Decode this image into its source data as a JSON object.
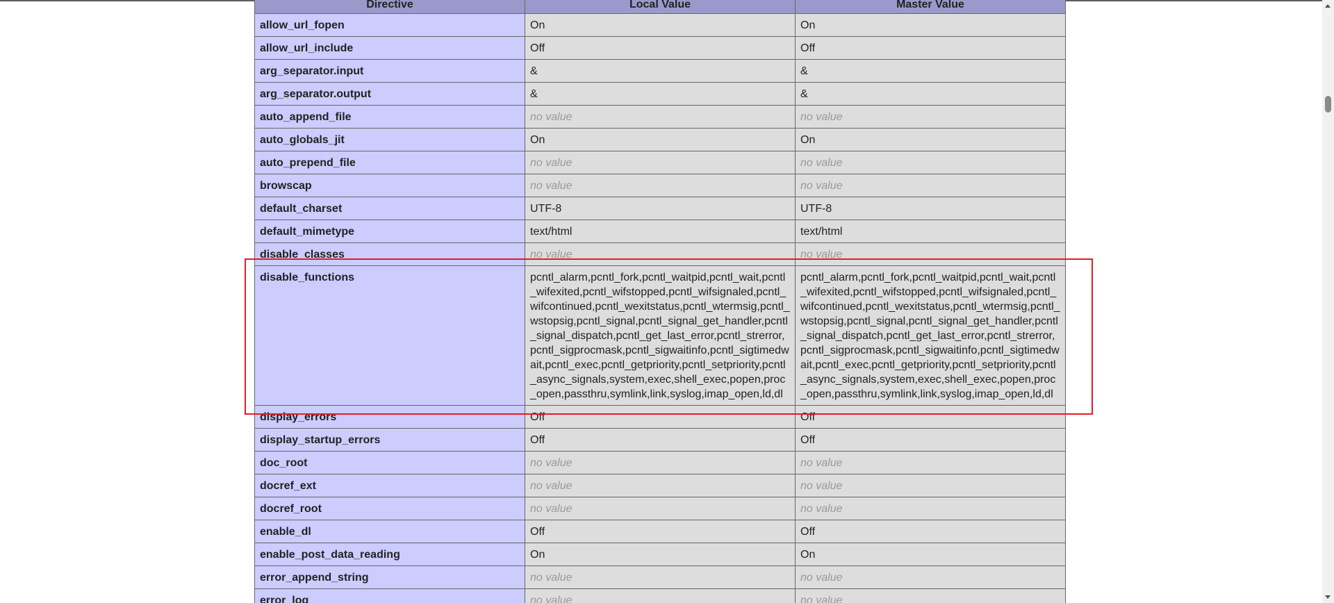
{
  "table": {
    "headers": [
      "Directive",
      "Local Value",
      "Master Value"
    ],
    "rows": [
      {
        "directive": "allow_url_fopen",
        "local": "On",
        "master": "On",
        "no_value": false
      },
      {
        "directive": "allow_url_include",
        "local": "Off",
        "master": "Off",
        "no_value": false
      },
      {
        "directive": "arg_separator.input",
        "local": "&",
        "master": "&",
        "no_value": false
      },
      {
        "directive": "arg_separator.output",
        "local": "&",
        "master": "&",
        "no_value": false
      },
      {
        "directive": "auto_append_file",
        "local": "no value",
        "master": "no value",
        "no_value": true
      },
      {
        "directive": "auto_globals_jit",
        "local": "On",
        "master": "On",
        "no_value": false
      },
      {
        "directive": "auto_prepend_file",
        "local": "no value",
        "master": "no value",
        "no_value": true
      },
      {
        "directive": "browscap",
        "local": "no value",
        "master": "no value",
        "no_value": true
      },
      {
        "directive": "default_charset",
        "local": "UTF-8",
        "master": "UTF-8",
        "no_value": false
      },
      {
        "directive": "default_mimetype",
        "local": "text/html",
        "master": "text/html",
        "no_value": false
      },
      {
        "directive": "disable_classes",
        "local": "no value",
        "master": "no value",
        "no_value": true
      },
      {
        "directive": "disable_functions",
        "local": "pcntl_alarm,pcntl_fork,pcntl_waitpid,pcntl_wait,pcntl_wifexited,pcntl_wifstopped,pcntl_wifsignaled,pcntl_wifcontinued,pcntl_wexitstatus,pcntl_wtermsig,pcntl_wstopsig,pcntl_signal,pcntl_signal_get_handler,pcntl_signal_dispatch,pcntl_get_last_error,pcntl_strerror,pcntl_sigprocmask,pcntl_sigwaitinfo,pcntl_sigtimedwait,pcntl_exec,pcntl_getpriority,pcntl_setpriority,pcntl_async_signals,system,exec,shell_exec,popen,proc_open,passthru,symlink,link,syslog,imap_open,ld,dl",
        "master": "pcntl_alarm,pcntl_fork,pcntl_waitpid,pcntl_wait,pcntl_wifexited,pcntl_wifstopped,pcntl_wifsignaled,pcntl_wifcontinued,pcntl_wexitstatus,pcntl_wtermsig,pcntl_wstopsig,pcntl_signal,pcntl_signal_get_handler,pcntl_signal_dispatch,pcntl_get_last_error,pcntl_strerror,pcntl_sigprocmask,pcntl_sigwaitinfo,pcntl_sigtimedwait,pcntl_exec,pcntl_getpriority,pcntl_setpriority,pcntl_async_signals,system,exec,shell_exec,popen,proc_open,passthru,symlink,link,syslog,imap_open,ld,dl",
        "no_value": false
      },
      {
        "directive": "display_errors",
        "local": "Off",
        "master": "Off",
        "no_value": false
      },
      {
        "directive": "display_startup_errors",
        "local": "Off",
        "master": "Off",
        "no_value": false
      },
      {
        "directive": "doc_root",
        "local": "no value",
        "master": "no value",
        "no_value": true
      },
      {
        "directive": "docref_ext",
        "local": "no value",
        "master": "no value",
        "no_value": true
      },
      {
        "directive": "docref_root",
        "local": "no value",
        "master": "no value",
        "no_value": true
      },
      {
        "directive": "enable_dl",
        "local": "Off",
        "master": "Off",
        "no_value": false
      },
      {
        "directive": "enable_post_data_reading",
        "local": "On",
        "master": "On",
        "no_value": false
      },
      {
        "directive": "error_append_string",
        "local": "no value",
        "master": "no value",
        "no_value": true
      },
      {
        "directive": "error_log",
        "local": "no value",
        "master": "no value",
        "no_value": true
      }
    ]
  },
  "colors": {
    "header_bg": "#9999cc",
    "directive_bg": "#ccccff",
    "value_bg": "#dddddd",
    "no_value_text": "#999999",
    "highlight_border": "#e11d26"
  }
}
